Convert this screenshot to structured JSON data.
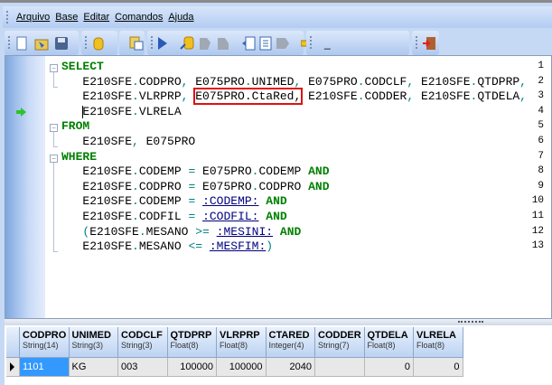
{
  "menu": [
    "Arquivo",
    "Base",
    "Editar",
    "Comandos",
    "Ajuda"
  ],
  "menu_accel": [
    "A",
    "B",
    "E",
    "C",
    "j"
  ],
  "toolbar": {
    "dash": "_"
  },
  "editor": {
    "line_numbers": [
      "1",
      "2",
      "3",
      "4",
      "5",
      "6",
      "7",
      "8",
      "9",
      "10",
      "11",
      "12",
      "13"
    ],
    "current_line": 4,
    "lines": [
      [
        {
          "t": "SELECT",
          "c": "kw"
        }
      ],
      [
        {
          "t": "   E210SFE"
        },
        {
          "t": ".",
          "c": "p"
        },
        {
          "t": "CODPRO"
        },
        {
          "t": ", ",
          "c": "p"
        },
        {
          "t": "E075PRO"
        },
        {
          "t": ".",
          "c": "p"
        },
        {
          "t": "UNIMED"
        },
        {
          "t": ", ",
          "c": "p"
        },
        {
          "t": "E075PRO"
        },
        {
          "t": ".",
          "c": "p"
        },
        {
          "t": "CODCLF"
        },
        {
          "t": ", ",
          "c": "p"
        },
        {
          "t": "E210SFE"
        },
        {
          "t": ".",
          "c": "p"
        },
        {
          "t": "QTDPRP"
        },
        {
          "t": ",",
          "c": "p"
        }
      ],
      [
        {
          "t": "   E210SFE"
        },
        {
          "t": ".",
          "c": "p"
        },
        {
          "t": "VLRPRP"
        },
        {
          "t": ", ",
          "c": "p"
        },
        {
          "t": "E075PRO.CtaRed,",
          "c": "hl"
        },
        {
          "t": " E210SFE"
        },
        {
          "t": ".",
          "c": "p"
        },
        {
          "t": "CODDER"
        },
        {
          "t": ", ",
          "c": "p"
        },
        {
          "t": "E210SFE"
        },
        {
          "t": ".",
          "c": "p"
        },
        {
          "t": "QTDELA"
        },
        {
          "t": ",",
          "c": "p"
        }
      ],
      [
        {
          "t": "   E210SFE"
        },
        {
          "t": ".",
          "c": "p"
        },
        {
          "t": "VLRELA"
        }
      ],
      [
        {
          "t": "FROM",
          "c": "kw"
        }
      ],
      [
        {
          "t": "   E210SFE"
        },
        {
          "t": ", ",
          "c": "p"
        },
        {
          "t": "E075PRO"
        }
      ],
      [
        {
          "t": "WHERE",
          "c": "kw"
        }
      ],
      [
        {
          "t": "   E210SFE"
        },
        {
          "t": ".",
          "c": "p"
        },
        {
          "t": "CODEMP "
        },
        {
          "t": "=",
          "c": "p"
        },
        {
          "t": " E075PRO"
        },
        {
          "t": ".",
          "c": "p"
        },
        {
          "t": "CODEMP "
        },
        {
          "t": "AND",
          "c": "kw"
        }
      ],
      [
        {
          "t": "   E210SFE"
        },
        {
          "t": ".",
          "c": "p"
        },
        {
          "t": "CODPRO "
        },
        {
          "t": "=",
          "c": "p"
        },
        {
          "t": " E075PRO"
        },
        {
          "t": ".",
          "c": "p"
        },
        {
          "t": "CODPRO "
        },
        {
          "t": "AND",
          "c": "kw"
        }
      ],
      [
        {
          "t": "   E210SFE"
        },
        {
          "t": ".",
          "c": "p"
        },
        {
          "t": "CODEMP "
        },
        {
          "t": "=",
          "c": "p"
        },
        {
          "t": " "
        },
        {
          "t": ":CODEMP:",
          "c": "par"
        },
        {
          "t": " "
        },
        {
          "t": "AND",
          "c": "kw"
        }
      ],
      [
        {
          "t": "   E210SFE"
        },
        {
          "t": ".",
          "c": "p"
        },
        {
          "t": "CODFIL "
        },
        {
          "t": "=",
          "c": "p"
        },
        {
          "t": " "
        },
        {
          "t": ":CODFIL:",
          "c": "par"
        },
        {
          "t": " "
        },
        {
          "t": "AND",
          "c": "kw"
        }
      ],
      [
        {
          "t": "   (",
          "c": "p"
        },
        {
          "t": "E210SFE"
        },
        {
          "t": ".",
          "c": "p"
        },
        {
          "t": "MESANO "
        },
        {
          "t": ">=",
          "c": "p"
        },
        {
          "t": " "
        },
        {
          "t": ":MESINI:",
          "c": "par"
        },
        {
          "t": " "
        },
        {
          "t": "AND",
          "c": "kw"
        }
      ],
      [
        {
          "t": "   E210SFE"
        },
        {
          "t": ".",
          "c": "p"
        },
        {
          "t": "MESANO "
        },
        {
          "t": "<=",
          "c": "p"
        },
        {
          "t": " "
        },
        {
          "t": ":MESFIM:",
          "c": "par"
        },
        {
          "t": ")",
          "c": "p"
        }
      ]
    ]
  },
  "grid": {
    "columns": [
      {
        "name": "CODPRO",
        "type": "String(14)"
      },
      {
        "name": "UNIMED",
        "type": "String(3)"
      },
      {
        "name": "CODCLF",
        "type": "String(3)"
      },
      {
        "name": "QTDPRP",
        "type": "Float(8)"
      },
      {
        "name": "VLRPRP",
        "type": "Float(8)"
      },
      {
        "name": "CTARED",
        "type": "Integer(4)"
      },
      {
        "name": "CODDER",
        "type": "String(7)"
      },
      {
        "name": "QTDELA",
        "type": "Float(8)"
      },
      {
        "name": "VLRELA",
        "type": "Float(8)"
      }
    ],
    "rows": [
      [
        "1101",
        "KG",
        "003",
        "100000",
        "100000",
        "2040",
        "",
        "0",
        "0"
      ]
    ]
  }
}
